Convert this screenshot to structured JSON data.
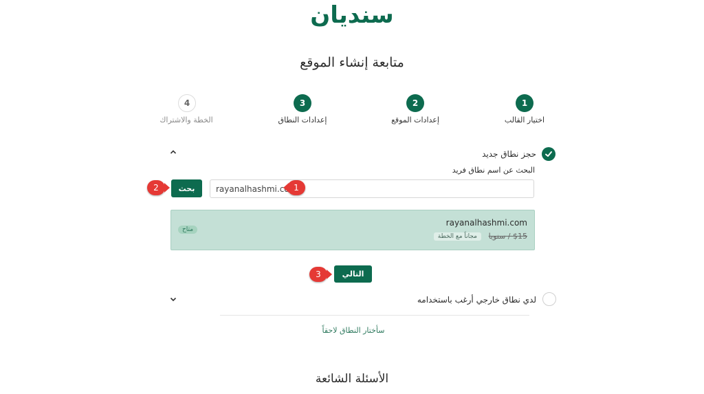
{
  "brand": {
    "logo_text": "سنديان"
  },
  "page": {
    "title": "متابعة إنشاء الموقع"
  },
  "steps": [
    {
      "number": "1",
      "label": "اختيار القالب"
    },
    {
      "number": "2",
      "label": "إعدادات الموقع"
    },
    {
      "number": "3",
      "label": "إعدادات النطاق"
    },
    {
      "number": "4",
      "label": "الخطة والاشتراك"
    }
  ],
  "new_domain": {
    "title": "حجز نطاق جديد",
    "search_label": "البحث عن اسم نطاق فريد",
    "search_value": "rayanalhashmi.com",
    "search_button": "بحث"
  },
  "result": {
    "domain": "rayanalhashmi.com",
    "old_price": "$15 / سنويا",
    "plan_note": "مجاناً مع الخطة",
    "status": "متاح"
  },
  "next_button": "التالي",
  "external_domain": {
    "title": "لدي نطاق خارجي أرغب باستخدامه"
  },
  "later_link": "سأختار النطاق لاحقاً",
  "faq_title": "الأسئلة الشائعة",
  "annotations": [
    "1",
    "2",
    "3"
  ],
  "colors": {
    "primary": "#0d6b4f",
    "marker": "#e53935",
    "result_bg": "#c4e0d6"
  }
}
